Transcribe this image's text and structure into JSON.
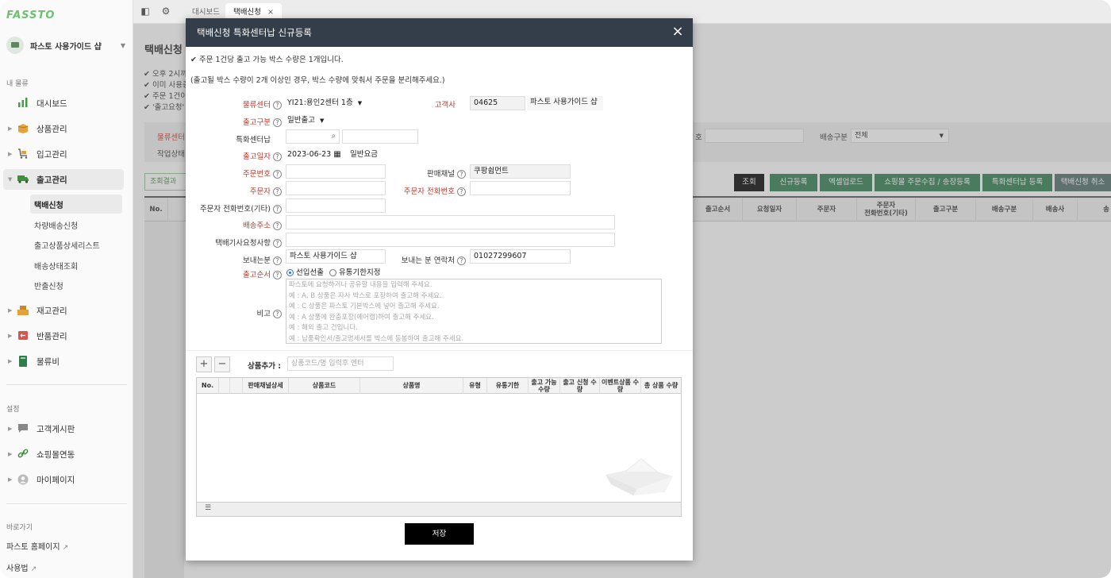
{
  "sidebar": {
    "logo": "FASSTO",
    "shop_name": "파스토 사용가이드 샵",
    "section_logistics": "내 물류",
    "items": [
      {
        "label": "대시보드"
      },
      {
        "label": "상품관리"
      },
      {
        "label": "입고관리"
      },
      {
        "label": "출고관리"
      },
      {
        "label": "재고관리"
      },
      {
        "label": "반품관리"
      },
      {
        "label": "물류비"
      }
    ],
    "sub_items": [
      {
        "label": "택배신청"
      },
      {
        "label": "차량배송신청"
      },
      {
        "label": "출고상품상세리스트"
      },
      {
        "label": "배송상태조회"
      },
      {
        "label": "반출신청"
      }
    ],
    "section_settings": "설정",
    "settings_items": [
      {
        "label": "고객게시판"
      },
      {
        "label": "쇼핑몰연동"
      },
      {
        "label": "마이페이지"
      }
    ],
    "section_shortcuts": "바로가기",
    "shortcuts": [
      {
        "label": "파스토 홈페이지"
      },
      {
        "label": "사용법"
      }
    ]
  },
  "tabs": [
    {
      "label": "대시보드"
    },
    {
      "label": "택배신청"
    }
  ],
  "background": {
    "title": "택배신청",
    "notes": [
      "✔ 오후 2시까",
      "✔ 이미 사용중",
      "✔ 주문 1건이",
      "✔ '출고요청'"
    ],
    "filter_label1": "물류센터",
    "filter_label2": "작업상태",
    "filter_label3": "호",
    "filter_label4": "배송구분",
    "filter_select": "전체",
    "result_btn": "조회결과",
    "buttons": [
      "조회",
      "신규등록",
      "엑셀업로드",
      "쇼핑몰 주문수집 / 송장등록",
      "특화센터납 등록",
      "택배신청 취소"
    ],
    "headers": [
      "No.",
      "출고순서",
      "요청일자",
      "주문자",
      "주문자\n전화번호(기타)",
      "출고구분",
      "배송구분",
      "배송사",
      "송"
    ]
  },
  "modal": {
    "title": "택배신청 특화센터납 신규등록",
    "note1": "✔ 주문 1건당 출고 가능 박스 수량은 1개입니다.",
    "note2": "(출고될 박스 수량이 2개 이상인 경우, 박스 수량에 맞춰서 주문을 분리해주세요.)",
    "labels": {
      "center": "물류센터",
      "customer": "고객사",
      "out_type": "출고구분",
      "special": "특화센터납",
      "out_date": "출고일자",
      "order_no": "주문번호",
      "channel": "판매채널",
      "orderer": "주문자",
      "orderer_phone": "주문자 전화번호",
      "orderer_phone_etc": "주문자 전화번호(기타)",
      "address": "배송주소",
      "driver_req": "택배기사요청사항",
      "sender": "보내는분",
      "sender_phone": "보내는 분 연락처",
      "out_order": "출고순서",
      "memo": "비고"
    },
    "values": {
      "center": "YI21:용인2센터 1층",
      "customer_code": "04625",
      "customer_name": "파스토 사용가이드 샵",
      "out_type": "일반출고",
      "out_date": "2023-06-23",
      "rate": "일반요금",
      "channel": "쿠팡쉽먼트",
      "sender": "파스토 사용가이드 샵",
      "sender_phone": "01027299607"
    },
    "radio1": "선입선출",
    "radio2": "유통기한지정",
    "memo_lines": [
      "파스토에 요청하거나 공유할 내용을 입력해 주세요.",
      "   예 : A, B 상품은 자사 박스로 포장하여 출고해 주세요.",
      "   예 : C 상품은 파스토 기본박스에 넣어 출고해 주세요.",
      "   예 : A 상품에 완충포장(에어캡)하여 출고해 주세요.",
      "   예 : 해외 출고 건입니다.",
      "   예 : 납품확인서/출고명세서를 박스에 동봉하여 출고해 주세요."
    ],
    "product_add_label": "상품추가 :",
    "product_placeholder": "상품코드/명 입력후 엔터",
    "product_headers": [
      "No.",
      "판매채널상세",
      "상품코드",
      "상품명",
      "유형",
      "유통기한",
      "출고 가능 수량",
      "출고 신청 수량",
      "이벤트상품 수량",
      "총 상품 수량"
    ],
    "save": "저장",
    "close": "×"
  }
}
